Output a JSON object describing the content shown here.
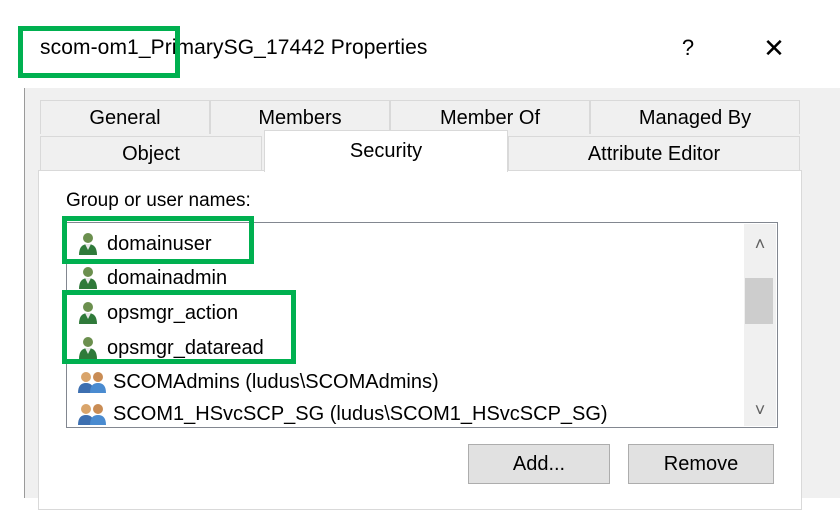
{
  "window": {
    "title": "scom-om1_PrimarySG_17442 Properties",
    "help_label": "?",
    "close_label": "✕"
  },
  "tabs": {
    "row1": [
      "General",
      "Members",
      "Member Of",
      "Managed By"
    ],
    "row2": [
      "Object",
      "Security",
      "Attribute Editor"
    ],
    "active": "Security"
  },
  "security": {
    "group_label": "Group or user names:",
    "names": [
      {
        "label": "domainuser",
        "icon": "user-icon"
      },
      {
        "label": "domainadmin",
        "icon": "user-icon"
      },
      {
        "label": "opsmgr_action",
        "icon": "user-icon"
      },
      {
        "label": "opsmgr_dataread",
        "icon": "user-icon"
      },
      {
        "label": "SCOMAdmins (ludus\\SCOMAdmins)",
        "icon": "group-icon"
      },
      {
        "label": "SCOM1_HSvcSCP_SG (ludus\\SCOM1_HSvcSCP_SG)",
        "icon": "group-icon"
      }
    ],
    "add_label": "Add...",
    "remove_label": "Remove"
  },
  "colors": {
    "highlight": "#00b050",
    "panel": "#f0f0f0"
  }
}
